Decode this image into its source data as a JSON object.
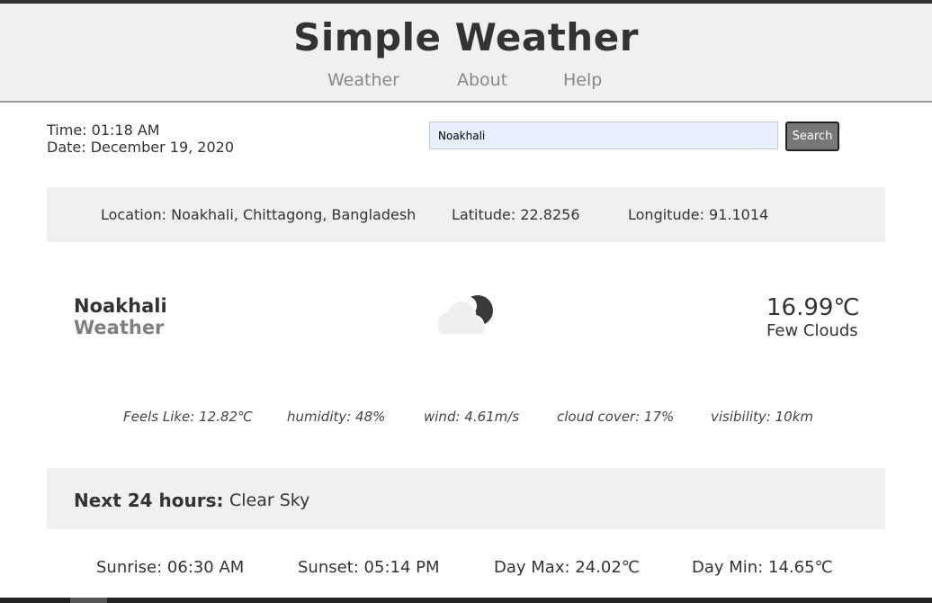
{
  "header": {
    "title": "Simple Weather",
    "nav": [
      "Weather",
      "About",
      "Help"
    ]
  },
  "datetime": {
    "time": "Time: 01:18 AM",
    "date": "Date: December 19, 2020"
  },
  "search": {
    "value": "Noakhali",
    "button_label": "Search"
  },
  "location": {
    "location": "Location: Noakhali, Chittagong, Bangladesh",
    "latitude": "Latitude: 22.8256",
    "longitude": "Longitude: 91.1014"
  },
  "current": {
    "city": "Noakhali",
    "subtitle": "Weather",
    "icon": "partly-cloudy-night-icon",
    "temperature": "16.99℃",
    "condition": "Few Clouds"
  },
  "details": {
    "feels_like": "Feels Like: 12.82℃",
    "humidity": "humidity: 48%",
    "wind": "wind: 4.61m/s",
    "cloud_cover": "cloud cover: 17%",
    "visibility": "visibility: 10km"
  },
  "forecast": {
    "label": "Next 24 hours:",
    "value": "Clear Sky"
  },
  "sun": {
    "sunrise": "Sunrise: 06:30 AM",
    "sunset": "Sunset: 05:14 PM",
    "day_max": "Day Max: 24.02℃",
    "day_min": "Day Min: 14.65℃"
  },
  "colors": {
    "header_bg": "#f0f0f0",
    "panel_bg": "#f0f0f0",
    "search_input_bg": "#e8f0fe",
    "search_button_bg": "#777777",
    "text": "#333333",
    "muted_text": "#808080"
  }
}
